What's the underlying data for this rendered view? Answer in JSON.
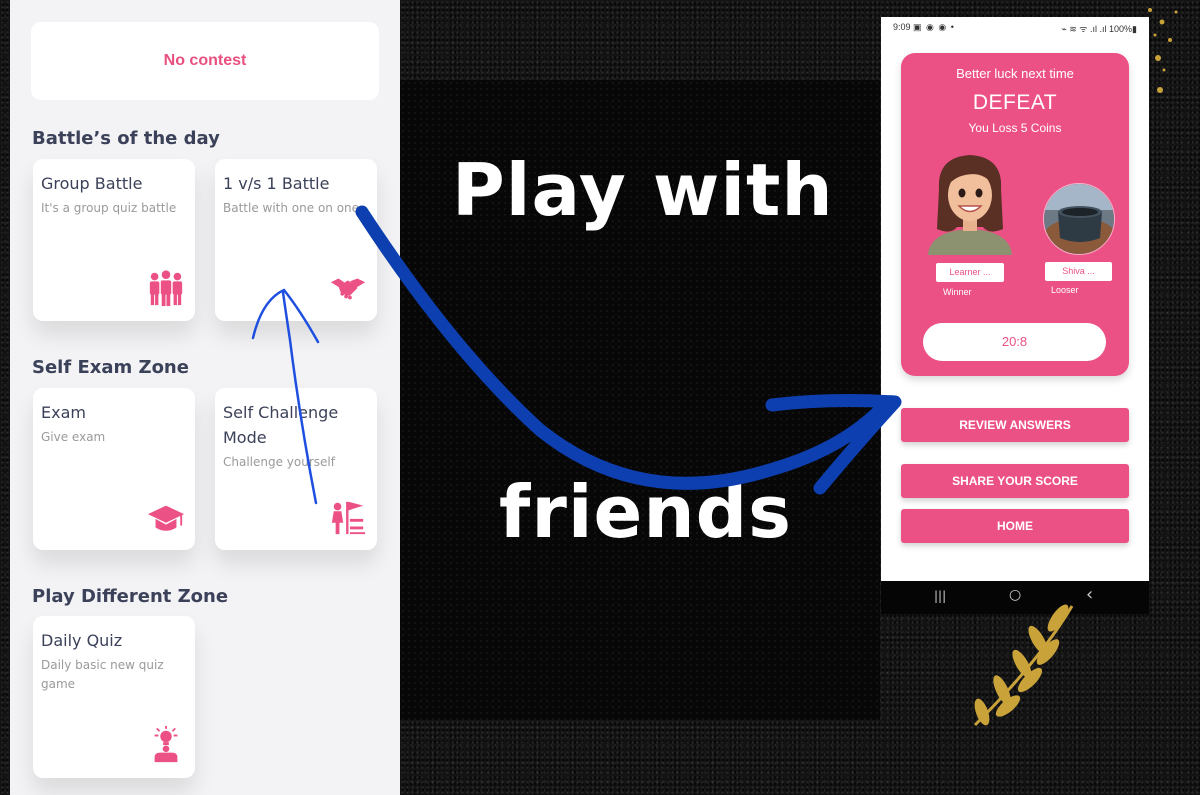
{
  "left_app": {
    "no_contest": "No contest",
    "sections": {
      "battles": "Battle’s of the day",
      "self_exam": "Self Exam Zone",
      "play_different": "Play Different Zone"
    },
    "cards": {
      "group_battle": {
        "title": "Group Battle",
        "desc": "It's a group quiz battle",
        "icon": "group-people-icon"
      },
      "one_vs_one": {
        "title": "1 v/s 1 Battle",
        "desc": "Battle with one on one",
        "icon": "handshake-icon"
      },
      "exam": {
        "title": "Exam",
        "desc": "Give exam",
        "icon": "graduation-cap-icon"
      },
      "self_challenge": {
        "title": "Self Challenge Mode",
        "desc": "Challenge yourself",
        "icon": "climb-flag-icon"
      },
      "daily_quiz": {
        "title": "Daily Quiz",
        "desc": "Daily basic new quiz game",
        "icon": "idea-person-icon"
      }
    }
  },
  "headline": {
    "line1": "Play with",
    "line2": "friends"
  },
  "phone": {
    "status": {
      "time": "9:09",
      "left_icons": "▣ ◉ ◉ •",
      "right": "⌁ ≋ ᯤ .ıl .ıl 100%▮"
    },
    "result": {
      "subtitle": "Better luck next time",
      "title": "DEFEAT",
      "loss": "You Loss 5 Coins",
      "winner_name": "Learner ...",
      "winner_label": "Winner",
      "loser_name": "Shiva ...",
      "loser_label": "Looser",
      "score": "20:8"
    },
    "buttons": {
      "review": "REVIEW ANSWERS",
      "share": "SHARE YOUR SCORE",
      "home": "HOME"
    },
    "nav": {
      "recents": "|||",
      "home": "○",
      "back": "‹"
    }
  },
  "colors": {
    "accent": "#ec5186",
    "heading": "#3b4159",
    "arrow_blue": "#0d3fb0"
  }
}
